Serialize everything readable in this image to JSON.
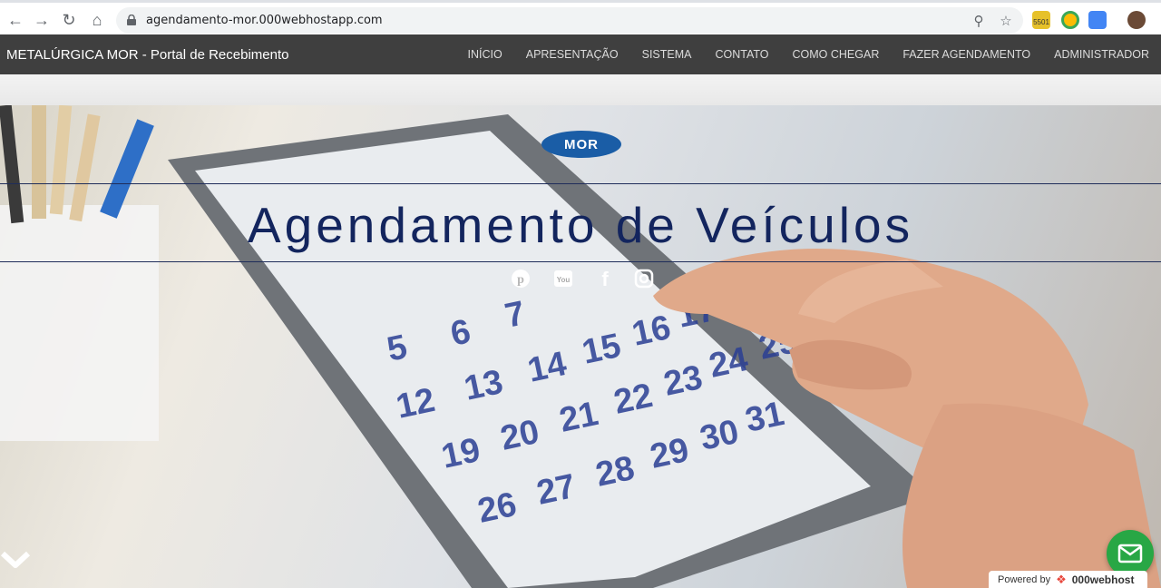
{
  "browser": {
    "url": "agendamento-mor.000webhostapp.com",
    "back_icon": "arrow-left-icon",
    "forward_icon": "arrow-right-icon",
    "reload_icon": "reload-icon",
    "home_icon": "home-icon",
    "extension_badge": "5501"
  },
  "site": {
    "brand": "METALÚRGICA MOR - Portal de Recebimento",
    "menu": [
      "INÍCIO",
      "APRESENTAÇÃO",
      "SISTEMA",
      "CONTATO",
      "COMO CHEGAR",
      "FAZER AGENDAMENTO",
      "ADMINISTRADOR"
    ]
  },
  "hero": {
    "logo_text": "MOR",
    "title": "Agendamento de Veículos",
    "social_icons": [
      "pinterest-icon",
      "youtube-icon",
      "facebook-icon",
      "instagram-icon"
    ],
    "scroll_icon": "chevron-down-icon"
  },
  "footer_badge": {
    "powered_by": "Powered by",
    "host": "000webhost"
  },
  "colors": {
    "nav_bg": "#3f3f3f",
    "title": "#13255e",
    "logo": "#1a5da6",
    "chat": "#28a745"
  }
}
